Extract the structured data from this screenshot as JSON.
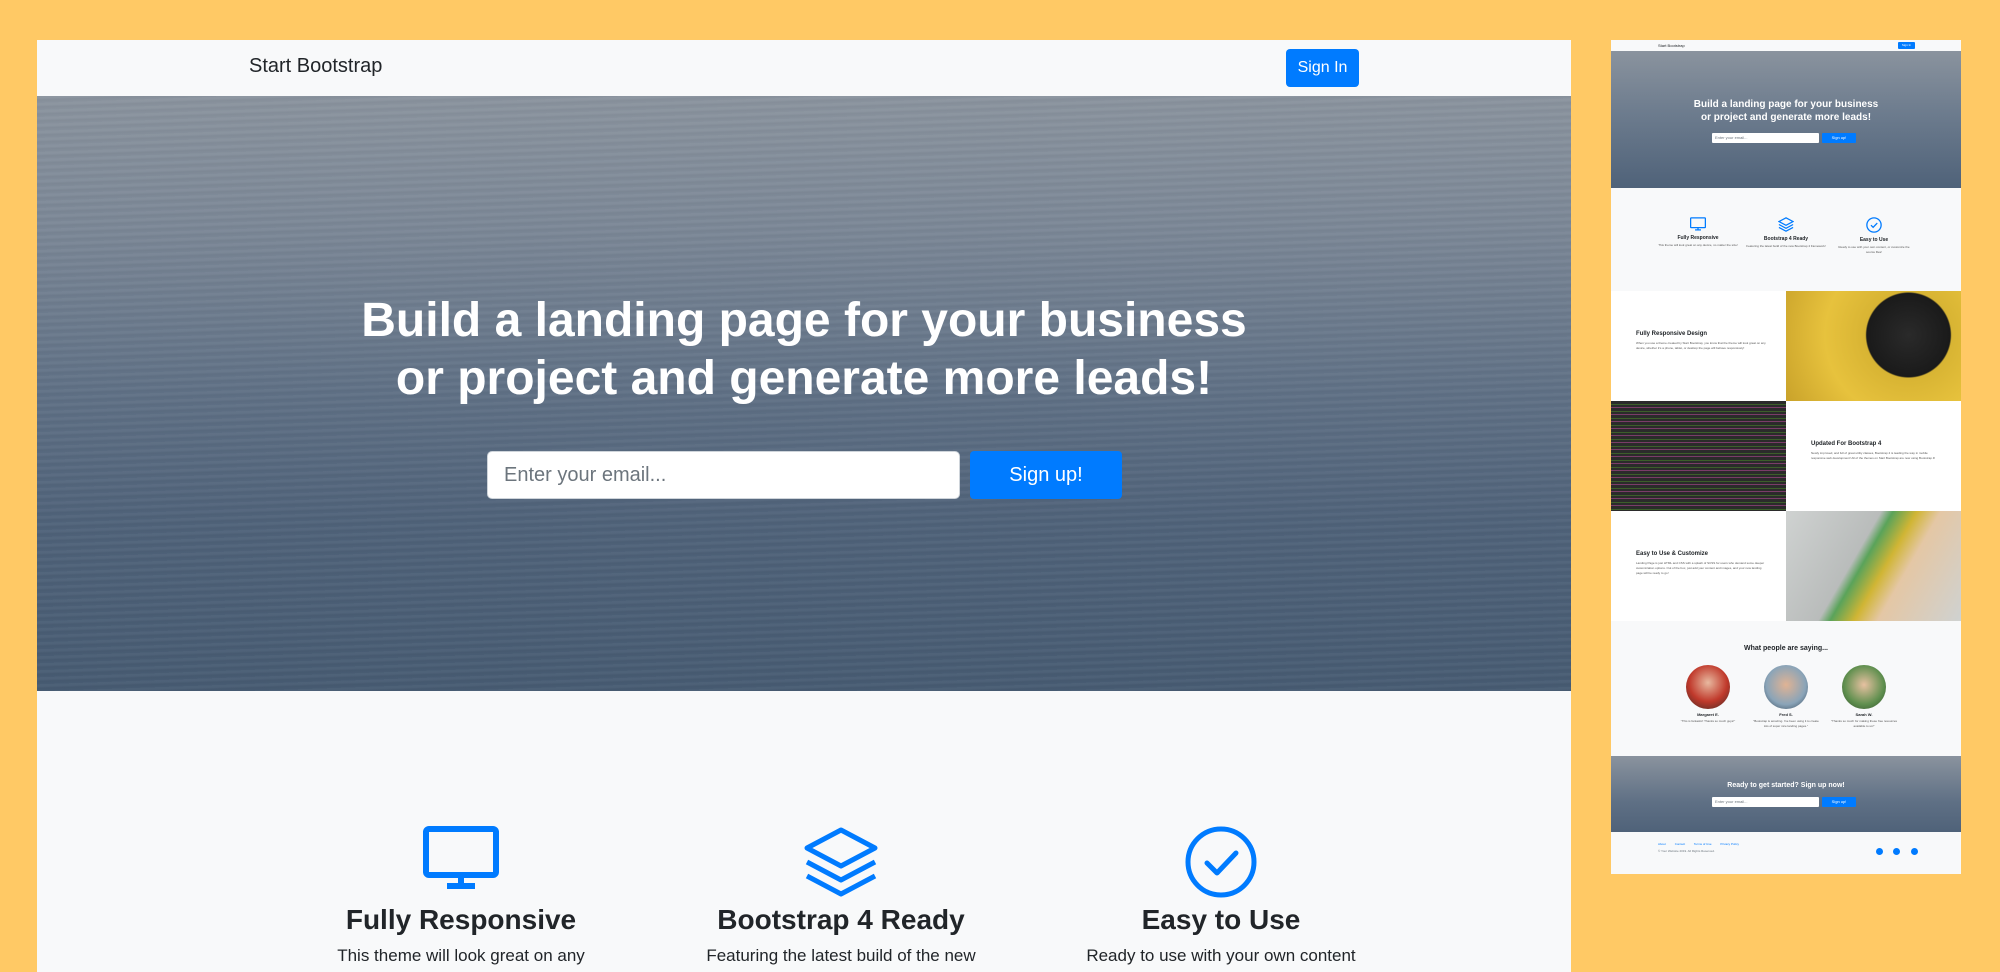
{
  "navbar": {
    "brand": "Start Bootstrap",
    "signin_label": "Sign In"
  },
  "hero": {
    "title_line1": "Build a landing page for your business",
    "title_line2": "or project and generate more leads!",
    "email_placeholder": "Enter your email...",
    "signup_label": "Sign up!"
  },
  "features": [
    {
      "icon": "monitor-icon",
      "title": "Fully Responsive",
      "text": "This theme will look great on any"
    },
    {
      "icon": "layers-icon",
      "title": "Bootstrap 4 Ready",
      "text": "Featuring the latest build of the new"
    },
    {
      "icon": "check-circle-icon",
      "title": "Easy to Use",
      "text": "Ready to use with your own content"
    }
  ],
  "thumbnail": {
    "brand": "Start Bootstrap",
    "signin": "Sign In",
    "hero_line1": "Build a landing page for your business",
    "hero_line2": "or project and generate more leads!",
    "email_placeholder": "Enter your email...",
    "signup": "Sign up!",
    "features": [
      {
        "title": "Fully Responsive",
        "text": "This theme will look great on any device, no matter the size!"
      },
      {
        "title": "Bootstrap 4 Ready",
        "text": "Featuring the latest build of the new Bootstrap 4 framework!"
      },
      {
        "title": "Easy to Use",
        "text": "Ready to use with your own content, or customize the source files!"
      }
    ],
    "showcase": [
      {
        "title": "Fully Responsive Design",
        "text": "When you use a theme created by Start Bootstrap, you know that the theme will look great on any device, whether it's a phone, tablet, or desktop the page will behave responsively!"
      },
      {
        "title": "Updated For Bootstrap 4",
        "text": "Newly improved, and full of great utility classes, Bootstrap 4 is leading the way in mobile responsive web development! All of the themes on Start Bootstrap are now using Bootstrap 4!"
      },
      {
        "title": "Easy to Use & Customize",
        "text": "Landing Page is just HTML and CSS with a splash of SCSS for users who demand some deeper customization options. Out of the box, just add your content and images, and your new landing page will be ready to go!"
      }
    ],
    "testimonials_title": "What people are saying...",
    "testimonials": [
      {
        "name": "Margaret E.",
        "quote": "\"This is fantastic! Thanks so much guys!\""
      },
      {
        "name": "Fred S.",
        "quote": "\"Bootstrap is amazing. I've been using it to create lots of super nice landing pages.\""
      },
      {
        "name": "Sarah W.",
        "quote": "\"Thanks so much for making these free resources available to us!\""
      }
    ],
    "cta_title": "Ready to get started? Sign up now!",
    "cta_placeholder": "Enter your email...",
    "cta_signup": "Sign up!",
    "footer_links": [
      "About",
      "Contact",
      "Terms of Use",
      "Privacy Policy"
    ],
    "footer_copy": "© Your Website 2019. All Rights Reserved."
  },
  "colors": {
    "primary": "#007bff",
    "page_bg": "#ffc965",
    "light_bg": "#f8f9fa"
  }
}
